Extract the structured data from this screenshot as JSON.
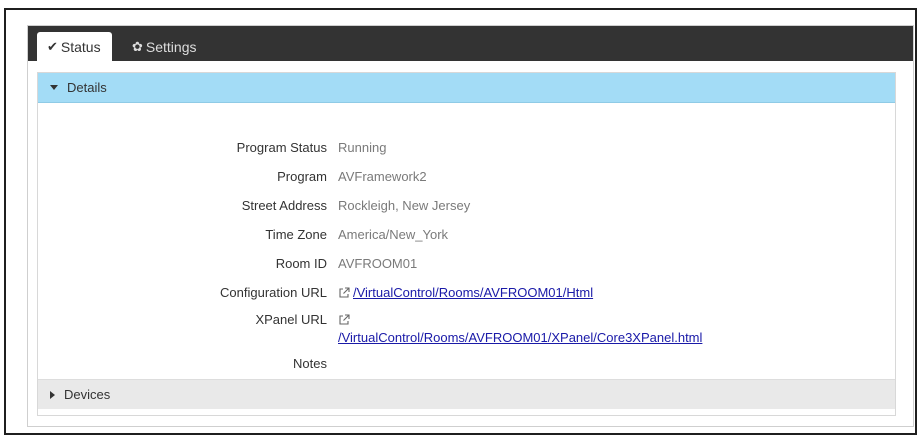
{
  "tabs": [
    {
      "label": "Status",
      "icon": "check-icon"
    },
    {
      "label": "Settings",
      "icon": "gear-icon"
    }
  ],
  "details": {
    "header": "Details",
    "fields": {
      "program_status": {
        "label": "Program Status",
        "value": "Running"
      },
      "program": {
        "label": "Program",
        "value": "AVFramework2"
      },
      "street_address": {
        "label": "Street Address",
        "value": "Rockleigh, New Jersey"
      },
      "time_zone": {
        "label": "Time Zone",
        "value": "America/New_York"
      },
      "room_id": {
        "label": "Room ID",
        "value": "AVFROOM01"
      },
      "configuration_url": {
        "label": "Configuration URL",
        "value": "/VirtualControl/Rooms/AVFROOM01/Html"
      },
      "xpanel_url": {
        "label": "XPanel URL",
        "value": "/VirtualControl/Rooms/AVFROOM01/XPanel/Core3XPanel.html"
      },
      "notes": {
        "label": "Notes",
        "value": ""
      }
    }
  },
  "devices": {
    "header": "Devices"
  },
  "colors": {
    "tabbar": "#333333",
    "details_header": "#a3dcf6",
    "link": "#1a1aa8"
  }
}
